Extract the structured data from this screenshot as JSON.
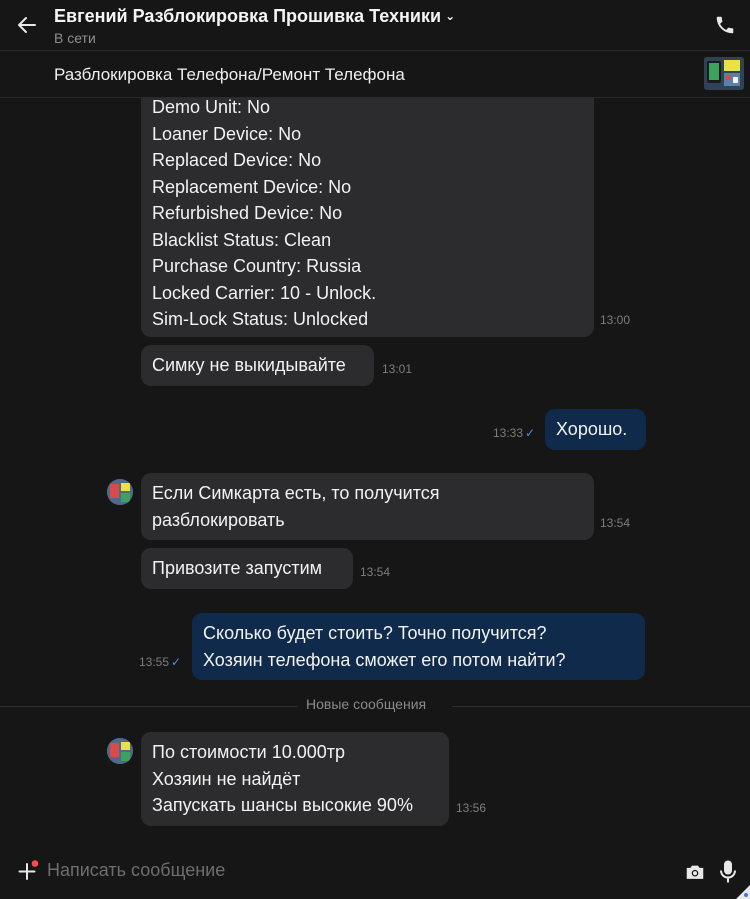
{
  "header": {
    "contact_name": "Евгений Разблокировка Прошивка Техники",
    "status": "В сети"
  },
  "product": {
    "title": "Разблокировка Телефона/Ремонт Телефона"
  },
  "messages": [
    {
      "direction": "in",
      "lines": [
        "Demo Unit: No",
        "Loaner Device: No",
        "Replaced Device: No",
        "Replacement Device: No",
        "Refurbished Device: No",
        "Blacklist Status: Clean",
        "Purchase Country: Russia",
        "Locked Carrier: 10 - Unlock.",
        "Sim-Lock Status: Unlocked"
      ],
      "time": "13:00"
    },
    {
      "direction": "in",
      "lines": [
        "Симку не выкидывайте"
      ],
      "time": "13:01"
    },
    {
      "direction": "out",
      "lines": [
        "Хорошо."
      ],
      "time": "13:33",
      "read": "✓"
    },
    {
      "direction": "in",
      "lines": [
        "Если Симкарта есть, то получится",
        "разблокировать"
      ],
      "time": "13:54"
    },
    {
      "direction": "in",
      "lines": [
        "Привозите запустим"
      ],
      "time": "13:54"
    },
    {
      "direction": "out",
      "lines": [
        "Сколько будет стоить? Точно получится?",
        "Хозяин телефона сможет его потом найти?"
      ],
      "time": "13:55",
      "read": "✓"
    },
    {
      "direction": "in",
      "lines": [
        "По стоимости 10.000тр",
        "Хозяин не найдёт",
        "Запускать шансы высокие 90%"
      ],
      "time": "13:56"
    }
  ],
  "new_messages_label": "Новые сообщения",
  "composer": {
    "placeholder": "Написать сообщение"
  },
  "colors": {
    "background": "#161616",
    "incoming_bubble": "#2c2c2e",
    "outgoing_bubble": "#0f2a4a",
    "read_check": "#4d8fd9",
    "unread_dot": "#ff4b4b"
  }
}
